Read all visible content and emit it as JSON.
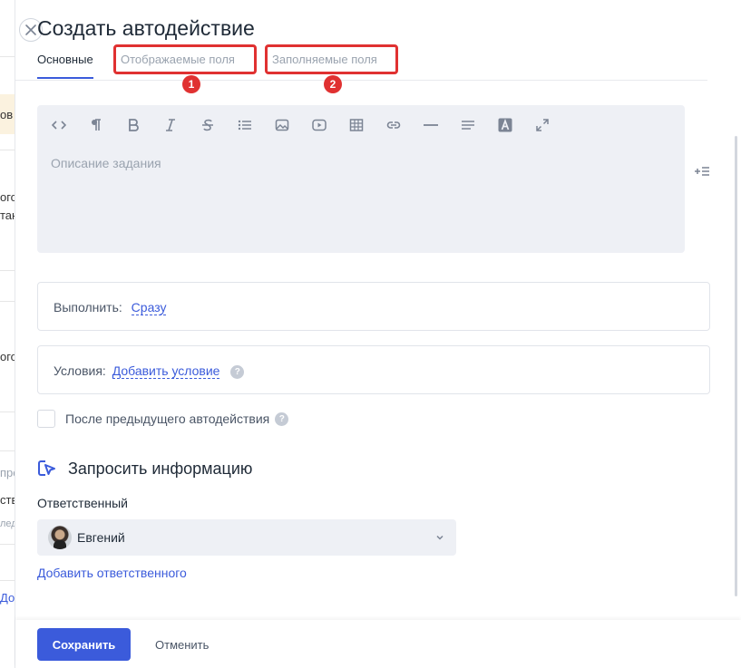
{
  "backdrop": {
    "fragments": [
      "ов",
      "ого",
      "тан",
      "ого",
      "пре",
      "ств",
      "лед",
      "До"
    ]
  },
  "modal": {
    "title": "Создать автодействие",
    "tabs": [
      {
        "label": "Основные",
        "active": true
      },
      {
        "label": "Отображаемые поля",
        "active": false
      },
      {
        "label": "Заполняемые поля",
        "active": false
      }
    ],
    "annotations": [
      {
        "number": "1"
      },
      {
        "number": "2"
      }
    ],
    "highlight_color": "#e03131",
    "editor": {
      "toolbar_icons": [
        "code-icon",
        "paragraph-icon",
        "bold-icon",
        "italic-icon",
        "strikethrough-icon",
        "bullet-list-icon",
        "image-icon",
        "video-icon",
        "table-icon",
        "link-icon",
        "horizontal-rule-icon",
        "align-icon",
        "text-color-icon",
        "fullscreen-icon"
      ],
      "placeholder": "Описание задания"
    },
    "execute": {
      "label": "Выполнить:",
      "value": "Сразу"
    },
    "conditions": {
      "label": "Условия:",
      "link": "Добавить условие",
      "help": "?"
    },
    "after_previous": {
      "label": "После предыдущего автодействия",
      "checked": false,
      "help": "?"
    },
    "request_section": {
      "title": "Запросить информацию"
    },
    "responsible": {
      "label": "Ответственный",
      "selected": "Евгений",
      "add_link": "Добавить ответственного"
    },
    "footer": {
      "save": "Сохранить",
      "cancel": "Отменить"
    },
    "accent_color": "#3b5bdb"
  }
}
